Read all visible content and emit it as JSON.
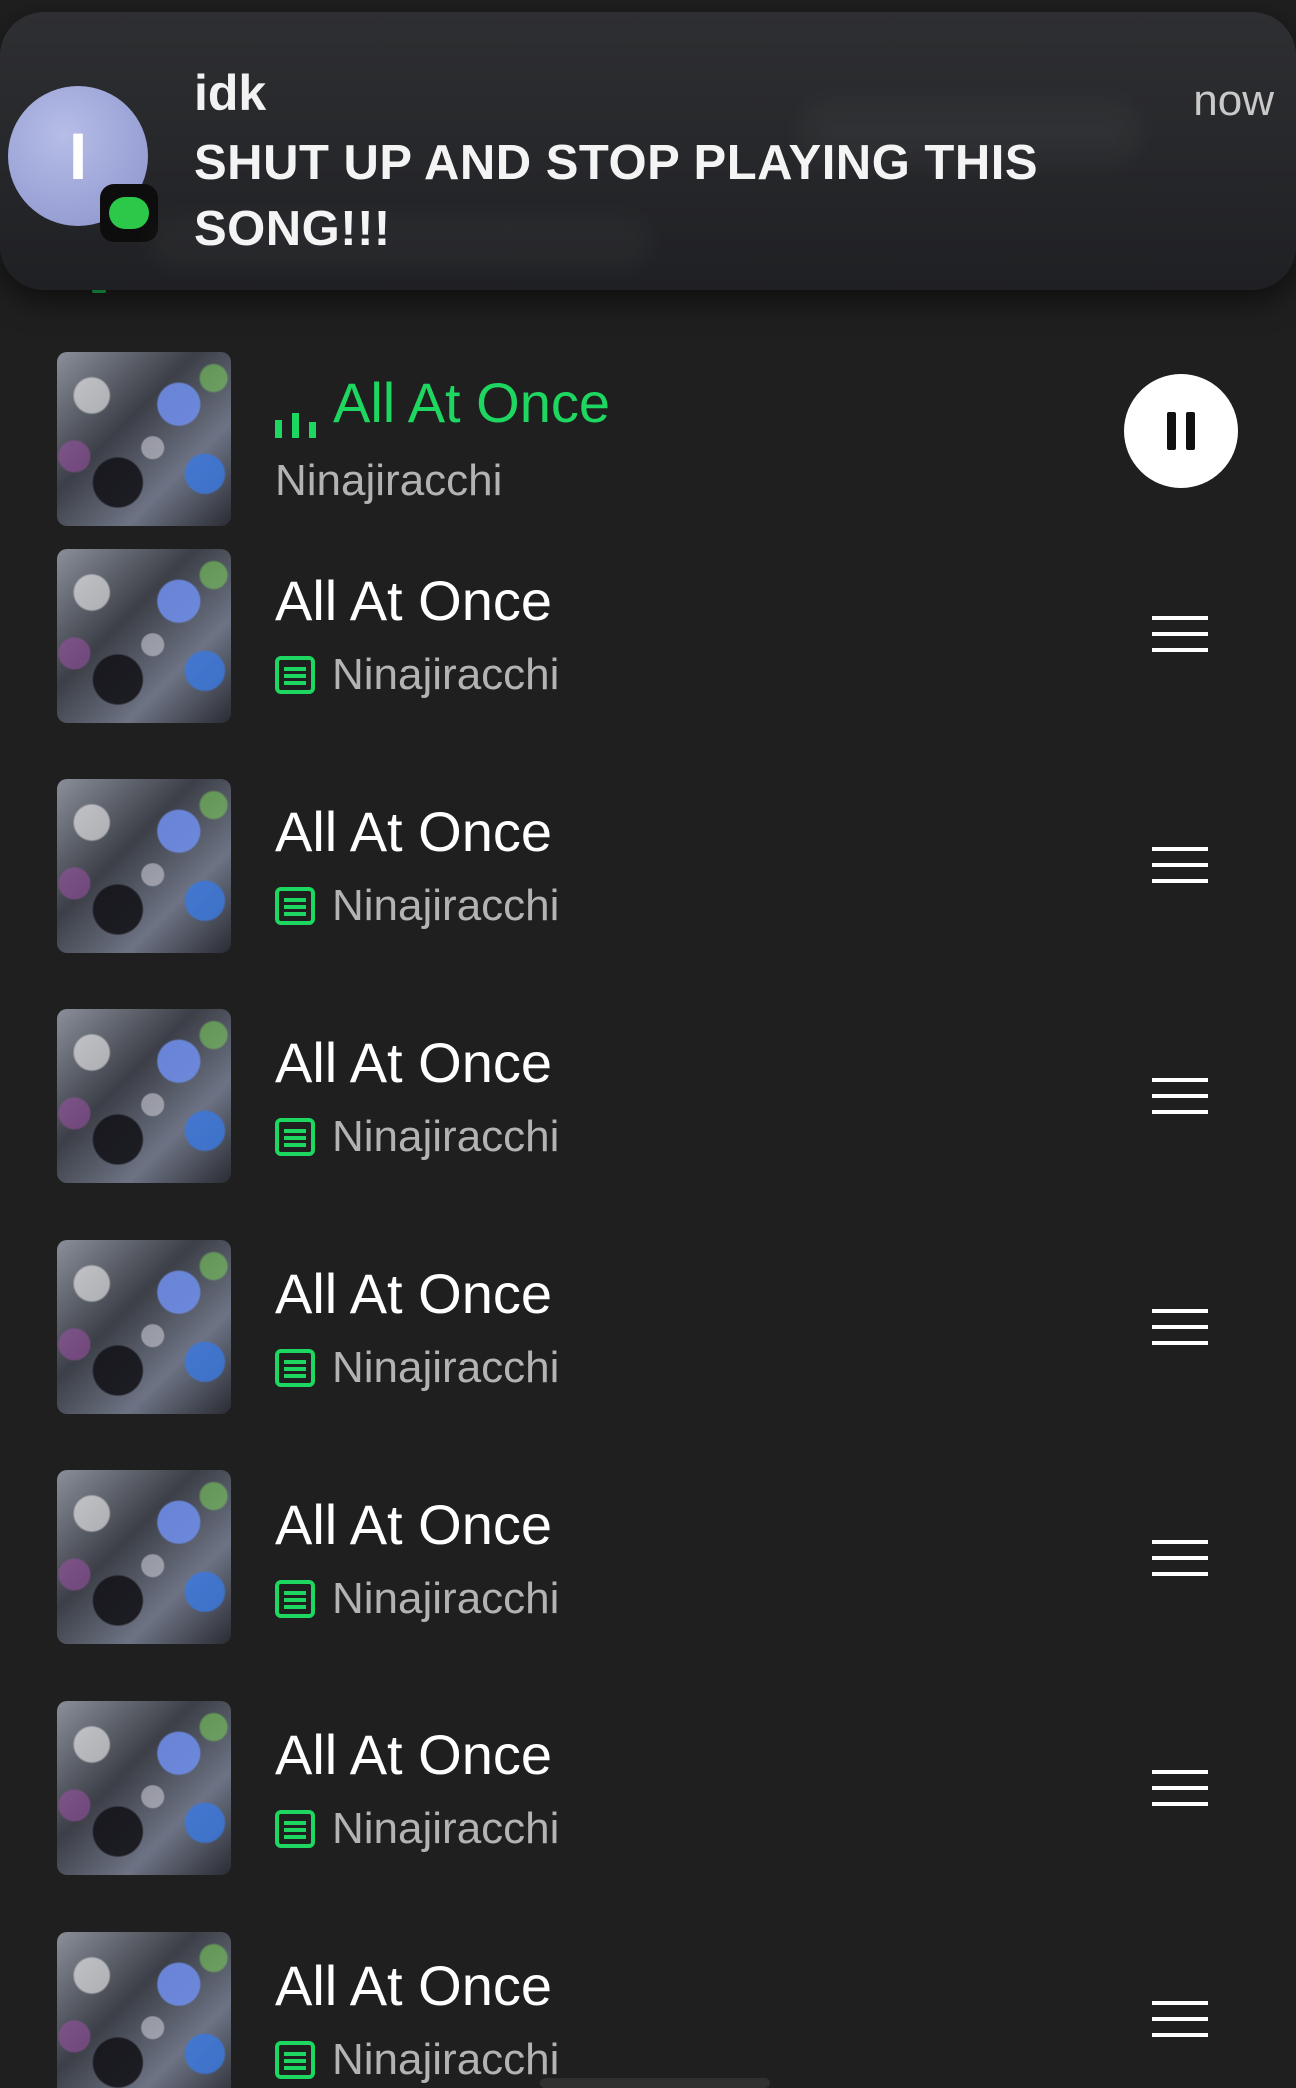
{
  "notification": {
    "sender": "idk",
    "time": "now",
    "message": "SHUT UP AND STOP PLAYING THIS SONG!!!",
    "avatar_letter": "I",
    "app_icon": "messages-bubble-icon",
    "app_color": "#2bc84a"
  },
  "now_playing": {
    "title": "All At Once",
    "artist": "Ninajiracchi",
    "state_icon": "equalizer-bars-icon",
    "control_icon": "pause-icon",
    "accent_color": "#1ed760"
  },
  "queue": {
    "items": [
      {
        "title": "All At Once",
        "artist": "Ninajiracchi",
        "badge_icon": "lyrics-icon",
        "handle_icon": "drag-handle-icon"
      },
      {
        "title": "All At Once",
        "artist": "Ninajiracchi",
        "badge_icon": "lyrics-icon",
        "handle_icon": "drag-handle-icon"
      },
      {
        "title": "All At Once",
        "artist": "Ninajiracchi",
        "badge_icon": "lyrics-icon",
        "handle_icon": "drag-handle-icon"
      },
      {
        "title": "All At Once",
        "artist": "Ninajiracchi",
        "badge_icon": "lyrics-icon",
        "handle_icon": "drag-handle-icon"
      },
      {
        "title": "All At Once",
        "artist": "Ninajiracchi",
        "badge_icon": "lyrics-icon",
        "handle_icon": "drag-handle-icon"
      },
      {
        "title": "All At Once",
        "artist": "Ninajiracchi",
        "badge_icon": "lyrics-icon",
        "handle_icon": "drag-handle-icon"
      },
      {
        "title": "All At Once",
        "artist": "Ninajiracchi",
        "badge_icon": "lyrics-icon",
        "handle_icon": "drag-handle-icon"
      }
    ]
  },
  "colors": {
    "background": "#1f1f1f",
    "accent_green": "#1ed760",
    "secondary_text": "#b3b3b3"
  }
}
